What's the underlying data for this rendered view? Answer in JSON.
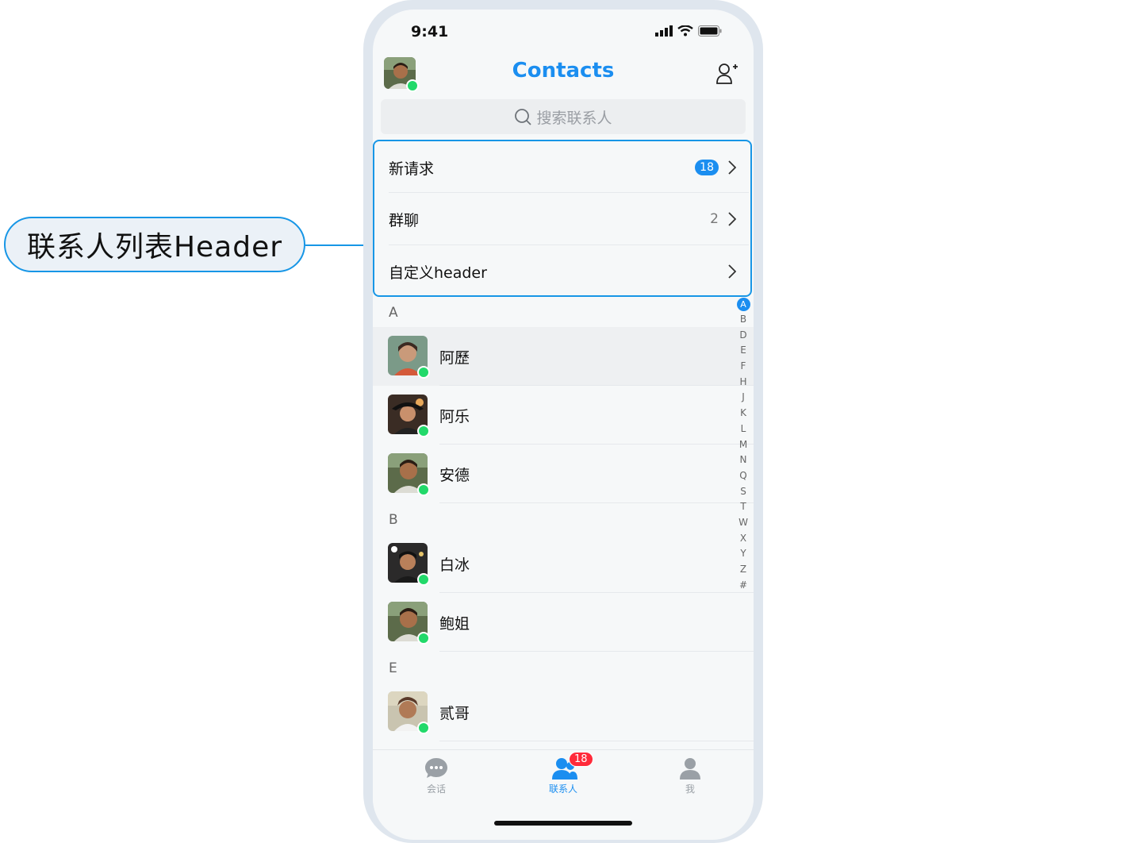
{
  "callout": {
    "label": "联系人列表Header"
  },
  "status": {
    "time": "9:41"
  },
  "topbar": {
    "title": "Contacts"
  },
  "search": {
    "placeholder": "搜索联系人"
  },
  "header_items": [
    {
      "label": "新请求",
      "badge": "18"
    },
    {
      "label": "群聊",
      "count": "2"
    },
    {
      "label": "自定义header"
    }
  ],
  "sections": [
    {
      "letter": "A",
      "contacts": [
        "阿歷",
        "阿乐",
        "安德"
      ]
    },
    {
      "letter": "B",
      "contacts": [
        "白冰",
        "鲍姐"
      ]
    },
    {
      "letter": "E",
      "contacts": [
        "贰哥"
      ]
    }
  ],
  "alpha_index": [
    "A",
    "B",
    "D",
    "E",
    "F",
    "H",
    "J",
    "K",
    "L",
    "M",
    "N",
    "Q",
    "S",
    "T",
    "W",
    "X",
    "Y",
    "Z",
    "#"
  ],
  "alpha_active": "A",
  "tabs": [
    {
      "label": "会话",
      "icon": "chat-bubble-icon"
    },
    {
      "label": "联系人",
      "icon": "contacts-icon",
      "badge": "18"
    },
    {
      "label": "我",
      "icon": "person-icon"
    }
  ],
  "colors": {
    "accent": "#1b8ef0",
    "badge_red": "#ff2a3a",
    "online": "#22d96a"
  }
}
